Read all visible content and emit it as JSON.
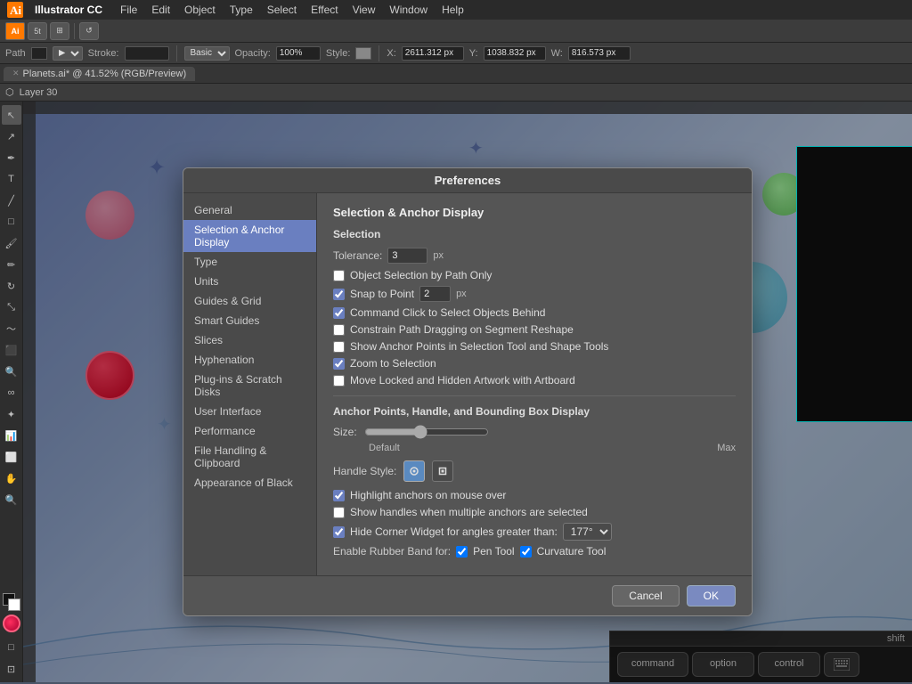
{
  "app": {
    "name": "Illustrator CC",
    "menu_items": [
      "File",
      "Edit",
      "Object",
      "Type",
      "Select",
      "Effect",
      "View",
      "Window",
      "Help"
    ]
  },
  "toolbar": {
    "path_label": "Path",
    "stroke_label": "Stroke:",
    "opacity_label": "Opacity:",
    "opacity_value": "100%",
    "style_label": "Style:",
    "stroke_style": "Basic",
    "x_label": "X:",
    "x_value": "2611.312 px",
    "y_label": "Y:",
    "y_value": "1038.832 px",
    "w_label": "W:",
    "w_value": "816.573 px"
  },
  "tab": {
    "filename": "Planets.ai*",
    "zoom": "41.52%",
    "mode": "RGB/Preview"
  },
  "layer": {
    "name": "Layer 30"
  },
  "preferences": {
    "title": "Preferences",
    "sidebar_items": [
      {
        "id": "general",
        "label": "General"
      },
      {
        "id": "selection-anchor",
        "label": "Selection & Anchor Display",
        "active": true
      },
      {
        "id": "type",
        "label": "Type"
      },
      {
        "id": "units",
        "label": "Units"
      },
      {
        "id": "guides-grid",
        "label": "Guides & Grid"
      },
      {
        "id": "smart-guides",
        "label": "Smart Guides"
      },
      {
        "id": "slices",
        "label": "Slices"
      },
      {
        "id": "hyphenation",
        "label": "Hyphenation"
      },
      {
        "id": "plug-ins",
        "label": "Plug-ins & Scratch Disks"
      },
      {
        "id": "user-interface",
        "label": "User Interface"
      },
      {
        "id": "performance",
        "label": "Performance"
      },
      {
        "id": "file-handling",
        "label": "File Handling & Clipboard"
      },
      {
        "id": "appearance",
        "label": "Appearance of Black"
      }
    ],
    "section_title": "Selection & Anchor Display",
    "selection_subtitle": "Selection",
    "tolerance_label": "Tolerance:",
    "tolerance_value": "3",
    "tolerance_unit": "px",
    "checkboxes": [
      {
        "id": "obj-sel-path",
        "label": "Object Selection by Path Only",
        "checked": false
      },
      {
        "id": "snap-point",
        "label": "Snap to Point",
        "checked": true,
        "has_input": true,
        "input_value": "2",
        "unit": "px"
      },
      {
        "id": "cmd-click",
        "label": "Command Click to Select Objects Behind",
        "checked": true
      },
      {
        "id": "constrain-path",
        "label": "Constrain Path Dragging on Segment Reshape",
        "checked": false
      },
      {
        "id": "show-anchor",
        "label": "Show Anchor Points in Selection Tool and Shape Tools",
        "checked": false
      },
      {
        "id": "zoom-sel",
        "label": "Zoom to Selection",
        "checked": true
      },
      {
        "id": "move-locked",
        "label": "Move Locked and Hidden Artwork with Artboard",
        "checked": false
      }
    ],
    "anchor_section_title": "Anchor Points, Handle, and Bounding Box Display",
    "size_label": "Size:",
    "size_default": "Default",
    "size_max": "Max",
    "handle_style_label": "Handle Style:",
    "anchor_checkboxes": [
      {
        "id": "highlight-anchors",
        "label": "Highlight anchors on mouse over",
        "checked": true
      },
      {
        "id": "show-handles",
        "label": "Show handles when multiple anchors are selected",
        "checked": false
      },
      {
        "id": "hide-corner",
        "label": "Hide Corner Widget for angles greater than:",
        "checked": true,
        "has_select": true,
        "select_value": "177°"
      }
    ],
    "rubber_band_label": "Enable Rubber Band for:",
    "rubber_band_checkboxes": [
      {
        "id": "pen-tool",
        "label": "Pen Tool",
        "checked": true
      },
      {
        "id": "curvature-tool",
        "label": "Curvature Tool",
        "checked": true
      }
    ],
    "cancel_label": "Cancel",
    "ok_label": "OK"
  },
  "keyboard_shortcuts": {
    "shift_label": "shift",
    "command_label": "command",
    "option_label": "option",
    "control_label": "control",
    "keyboard_icon_label": "keyboard"
  }
}
